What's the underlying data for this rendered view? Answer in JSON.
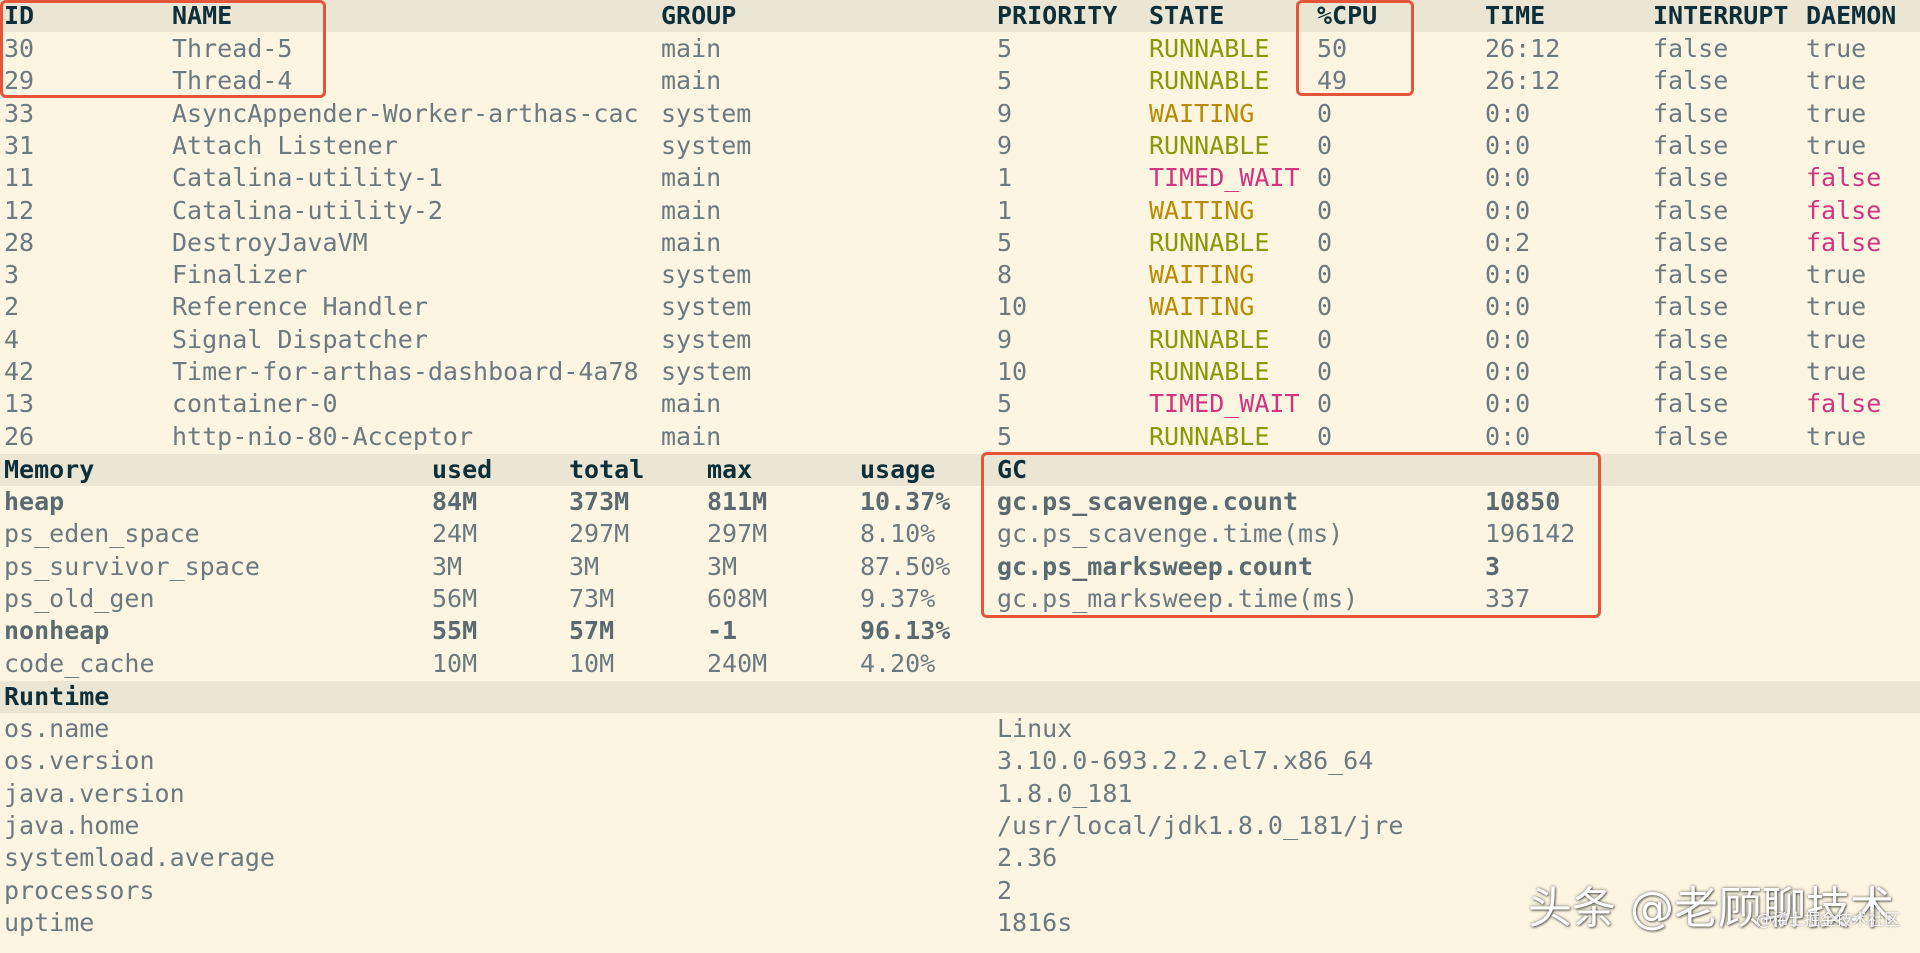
{
  "threads": {
    "columns": {
      "id": "ID",
      "name": "NAME",
      "group": "GROUP",
      "priority": "PRIORITY",
      "state": "STATE",
      "cpu": "%CPU",
      "time": "TIME",
      "interrupt": "INTERRUPT",
      "daemon": "DAEMON"
    },
    "rows": [
      {
        "id": "30",
        "name": "Thread-5",
        "group": "main",
        "priority": "5",
        "state": "RUNNABLE",
        "cpu": "50",
        "time": "26:12",
        "interrupt": "false",
        "daemon": "true"
      },
      {
        "id": "29",
        "name": "Thread-4",
        "group": "main",
        "priority": "5",
        "state": "RUNNABLE",
        "cpu": "49",
        "time": "26:12",
        "interrupt": "false",
        "daemon": "true"
      },
      {
        "id": "33",
        "name": "AsyncAppender-Worker-arthas-cac",
        "group": "system",
        "priority": "9",
        "state": "WAITING",
        "cpu": "0",
        "time": "0:0",
        "interrupt": "false",
        "daemon": "true"
      },
      {
        "id": "31",
        "name": "Attach Listener",
        "group": "system",
        "priority": "9",
        "state": "RUNNABLE",
        "cpu": "0",
        "time": "0:0",
        "interrupt": "false",
        "daemon": "true"
      },
      {
        "id": "11",
        "name": "Catalina-utility-1",
        "group": "main",
        "priority": "1",
        "state": "TIMED_WAIT",
        "cpu": "0",
        "time": "0:0",
        "interrupt": "false",
        "daemon": "false"
      },
      {
        "id": "12",
        "name": "Catalina-utility-2",
        "group": "main",
        "priority": "1",
        "state": "WAITING",
        "cpu": "0",
        "time": "0:0",
        "interrupt": "false",
        "daemon": "false"
      },
      {
        "id": "28",
        "name": "DestroyJavaVM",
        "group": "main",
        "priority": "5",
        "state": "RUNNABLE",
        "cpu": "0",
        "time": "0:2",
        "interrupt": "false",
        "daemon": "false"
      },
      {
        "id": "3",
        "name": "Finalizer",
        "group": "system",
        "priority": "8",
        "state": "WAITING",
        "cpu": "0",
        "time": "0:0",
        "interrupt": "false",
        "daemon": "true"
      },
      {
        "id": "2",
        "name": "Reference Handler",
        "group": "system",
        "priority": "10",
        "state": "WAITING",
        "cpu": "0",
        "time": "0:0",
        "interrupt": "false",
        "daemon": "true"
      },
      {
        "id": "4",
        "name": "Signal Dispatcher",
        "group": "system",
        "priority": "9",
        "state": "RUNNABLE",
        "cpu": "0",
        "time": "0:0",
        "interrupt": "false",
        "daemon": "true"
      },
      {
        "id": "42",
        "name": "Timer-for-arthas-dashboard-4a78",
        "group": "system",
        "priority": "10",
        "state": "RUNNABLE",
        "cpu": "0",
        "time": "0:0",
        "interrupt": "false",
        "daemon": "true"
      },
      {
        "id": "13",
        "name": "container-0",
        "group": "main",
        "priority": "5",
        "state": "TIMED_WAIT",
        "cpu": "0",
        "time": "0:0",
        "interrupt": "false",
        "daemon": "false"
      },
      {
        "id": "26",
        "name": "http-nio-80-Acceptor",
        "group": "main",
        "priority": "5",
        "state": "RUNNABLE",
        "cpu": "0",
        "time": "0:0",
        "interrupt": "false",
        "daemon": "true"
      }
    ]
  },
  "memory": {
    "columns": {
      "name": "Memory",
      "used": "used",
      "total": "total",
      "max": "max",
      "usage": "usage"
    },
    "rows": [
      {
        "name": "heap",
        "used": "84M",
        "total": "373M",
        "max": "811M",
        "usage": "10.37%",
        "bold": true
      },
      {
        "name": "ps_eden_space",
        "used": "24M",
        "total": "297M",
        "max": "297M",
        "usage": "8.10%",
        "bold": false
      },
      {
        "name": "ps_survivor_space",
        "used": "3M",
        "total": "3M",
        "max": "3M",
        "usage": "87.50%",
        "bold": false
      },
      {
        "name": "ps_old_gen",
        "used": "56M",
        "total": "73M",
        "max": "608M",
        "usage": "9.37%",
        "bold": false
      },
      {
        "name": "nonheap",
        "used": "55M",
        "total": "57M",
        "max": "-1",
        "usage": "96.13%",
        "bold": true
      },
      {
        "name": "code_cache",
        "used": "10M",
        "total": "10M",
        "max": "240M",
        "usage": "4.20%",
        "bold": false
      }
    ]
  },
  "gc": {
    "title": "GC",
    "rows": [
      {
        "name": "gc.ps_scavenge.count",
        "value": "10850",
        "bold": true
      },
      {
        "name": "gc.ps_scavenge.time(ms)",
        "value": "196142",
        "bold": false
      },
      {
        "name": "gc.ps_marksweep.count",
        "value": "3",
        "bold": true
      },
      {
        "name": "gc.ps_marksweep.time(ms)",
        "value": "337",
        "bold": false
      }
    ]
  },
  "runtime": {
    "title": "Runtime",
    "rows": [
      {
        "name": "os.name",
        "value": "Linux"
      },
      {
        "name": "os.version",
        "value": "3.10.0-693.2.2.el7.x86_64"
      },
      {
        "name": "java.version",
        "value": "1.8.0_181"
      },
      {
        "name": "java.home",
        "value": "/usr/local/jdk1.8.0_181/jre"
      },
      {
        "name": "systemload.average",
        "value": "2.36"
      },
      {
        "name": "processors",
        "value": "2"
      },
      {
        "name": "uptime",
        "value": "1816s"
      }
    ]
  },
  "watermark": {
    "main": "头条 @老顾聊技术",
    "sub": "@稀土掘金技术社区"
  },
  "colors": {
    "background": "#fcf5e2",
    "header_band": "#ebe5d3",
    "header_text": "#0d2f3a",
    "body_text": "#6b7a80",
    "runnable": "#869a06",
    "waiting": "#b88b00",
    "timed_wait": "#d0357f",
    "daemon_false": "#d0357f",
    "highlight_box": "#e5553a"
  }
}
